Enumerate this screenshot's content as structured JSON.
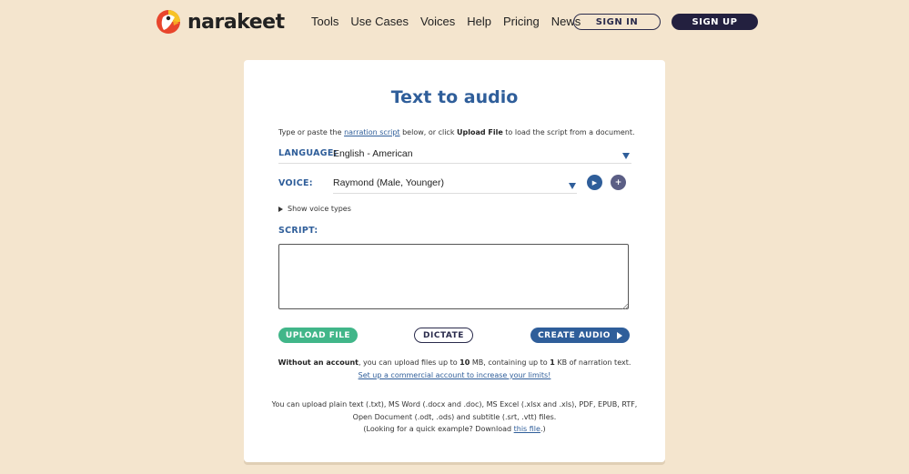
{
  "header": {
    "brand": "narakeet",
    "nav": [
      "Tools",
      "Use Cases",
      "Voices",
      "Help",
      "Pricing",
      "News"
    ],
    "signin_label": "SIGN IN",
    "signup_label": "SIGN UP"
  },
  "colors": {
    "background": "#f4e5ce",
    "accent_blue": "#2f5e9a",
    "dark_navy": "#23203f",
    "green": "#41b689"
  },
  "main": {
    "title": "Text to audio",
    "intro": {
      "part1": "Type or paste the ",
      "link": "narration script",
      "part2": " below, or click ",
      "bold": "Upload File",
      "part3": " to load the script from a document."
    },
    "language": {
      "label": "LANGUAGE:",
      "value": "English - American"
    },
    "voice": {
      "label": "VOICE:",
      "value": "Raymond (Male, Younger)"
    },
    "show_voice_types": "Show voice types",
    "script": {
      "label": "SCRIPT:",
      "value": ""
    },
    "buttons": {
      "upload": "UPLOAD FILE",
      "dictate": "DICTATE",
      "create": "CREATE AUDIO"
    },
    "limits": {
      "b1": "Without an account",
      "t1": ", you can upload files up to ",
      "b2": "10",
      "t2": " MB, containing up to ",
      "b3": "1",
      "t3": " KB of narration text.",
      "link": "Set up a commercial account to increase your limits!"
    },
    "formats": {
      "line1": "You can upload plain text (.txt), MS Word (.docx and .doc), MS Excel (.xlsx and .xls), PDF, EPUB, RTF,",
      "line2": "Open Document (.odt, .ods) and subtitle (.srt, .vtt) files.",
      "line3a": "(Looking for a quick example? Download ",
      "line3link": "this file",
      "line3b": ".)"
    }
  },
  "icons": [
    "narakeet-parrot-logo-icon",
    "chevron-down-icon",
    "play-icon",
    "plus-icon",
    "triangle-right-icon",
    "resize-grip-icon"
  ]
}
